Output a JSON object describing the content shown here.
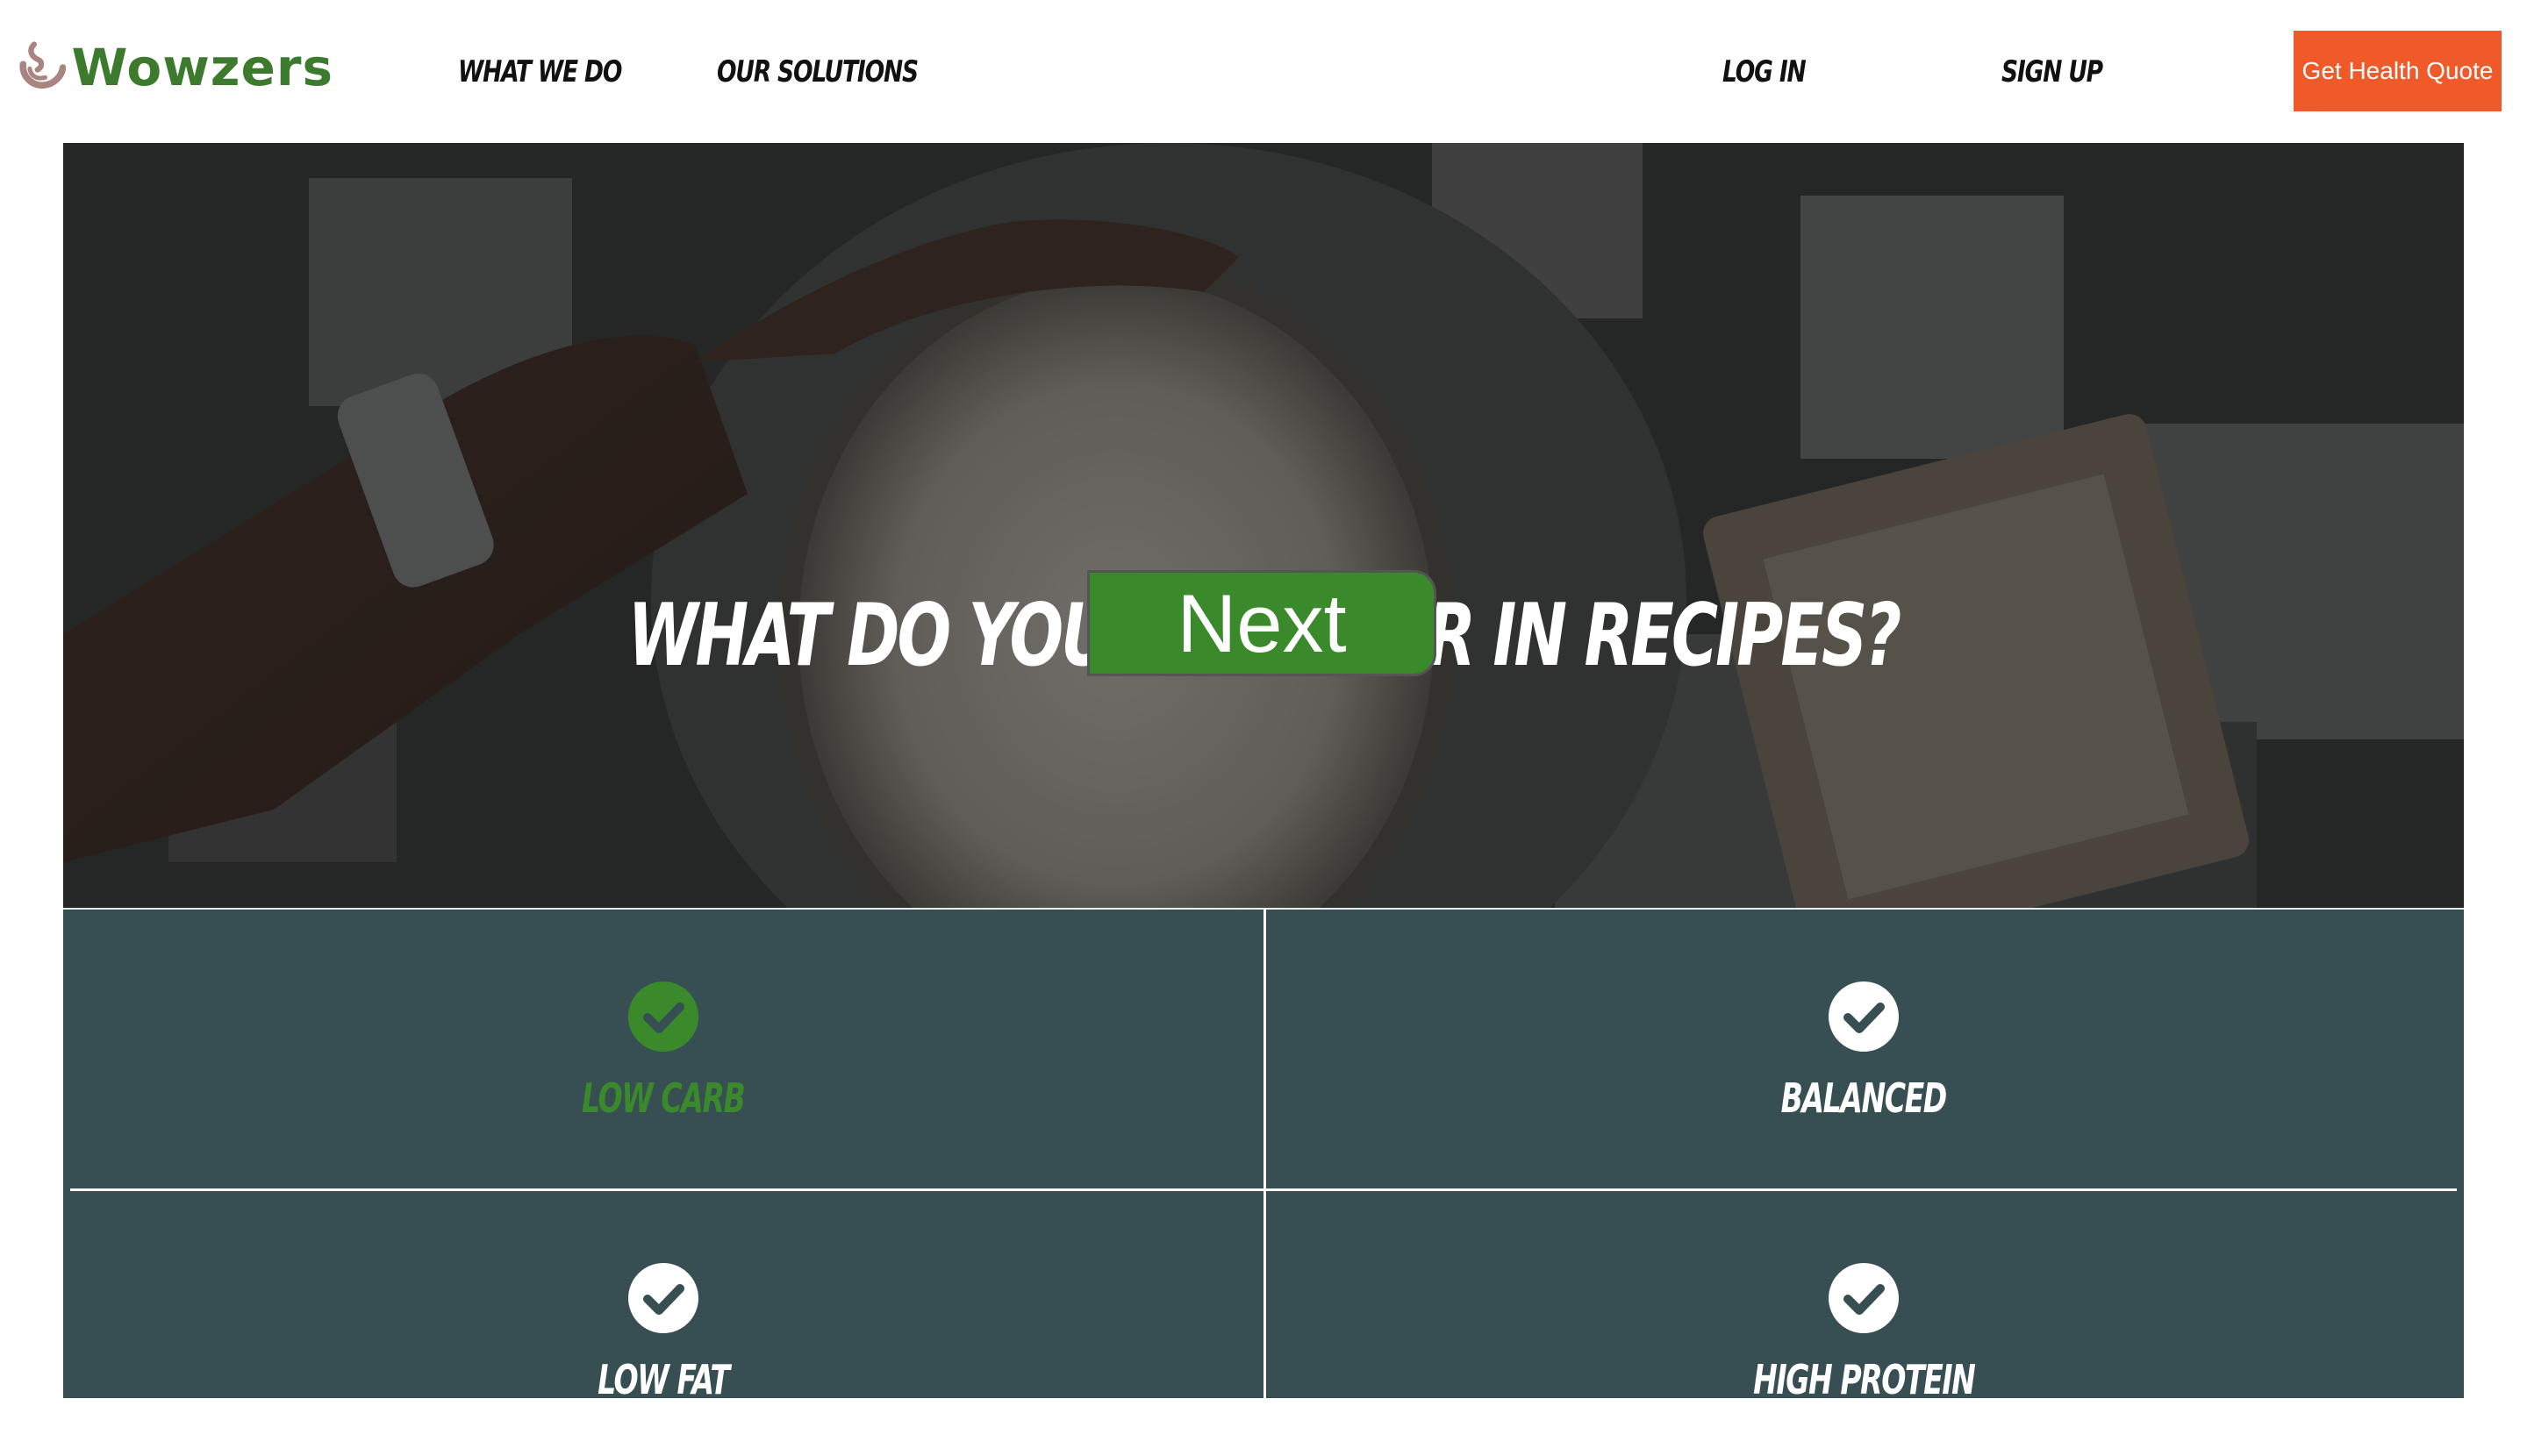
{
  "brand": {
    "name": "Wowzers",
    "logo_color": "#3c7a2e",
    "mark_color": "#a88580"
  },
  "nav": {
    "what_we_do": "WHAT WE DO",
    "our_solutions": "OUR SOLUTIONS",
    "log_in": "LOG IN",
    "sign_up": "SIGN UP",
    "quote_button": "Get Health Quote"
  },
  "hero": {
    "title": "WHAT DO YOU LOOK FOR IN RECIPES?",
    "next_button": "Next"
  },
  "options": [
    {
      "label": "LOW CARB",
      "selected": true,
      "icon": "check-circle-icon"
    },
    {
      "label": "BALANCED",
      "selected": false,
      "icon": "check-circle-icon"
    },
    {
      "label": "LOW FAT",
      "selected": false,
      "icon": "check-circle-icon"
    },
    {
      "label": "HIGH PROTEIN",
      "selected": false,
      "icon": "check-circle-icon"
    }
  ],
  "colors": {
    "accent_green": "#3a8a2c",
    "quote_orange": "#ef5a28",
    "panel_teal": "#374f52"
  }
}
